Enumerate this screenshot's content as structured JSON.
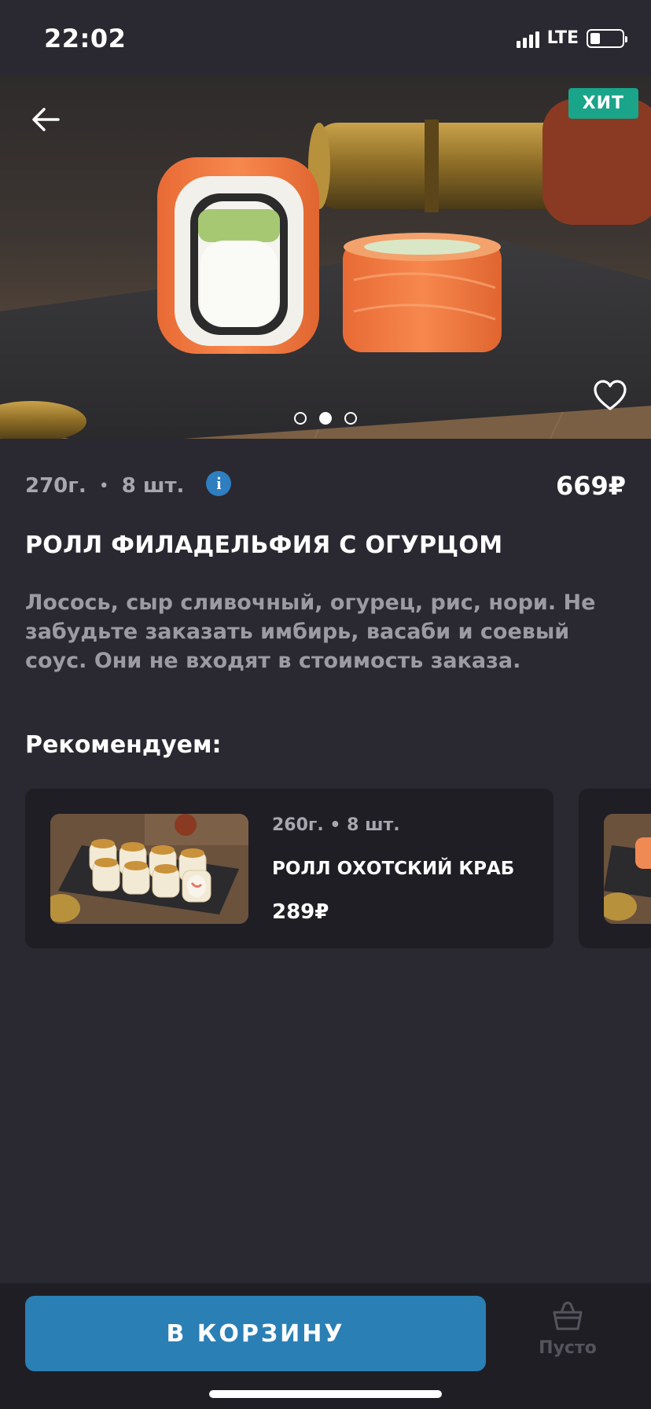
{
  "status_bar": {
    "time": "22:02",
    "network": "LTE"
  },
  "hero": {
    "badge": "ХИТ",
    "carousel": {
      "total": 3,
      "active_index": 1
    },
    "icons": [
      "back-arrow-icon",
      "heart-icon"
    ]
  },
  "product": {
    "weight": "270г.",
    "pieces": "8 шт.",
    "price": "669₽",
    "title": "РОЛЛ ФИЛАДЕЛЬФИЯ С ОГУРЦОМ",
    "description": "Лосось, сыр сливочный, огурец, рис, нори. Не забудьте заказать имбирь, васаби и соевый соус. Они не входят в стоимость заказа."
  },
  "recommend": {
    "heading": "Рекомендуем:",
    "items": [
      {
        "meta": "260г. • 8 шт.",
        "name": "РОЛЛ ОХОТСКИЙ КРАБ",
        "price": "289₽"
      }
    ]
  },
  "bottom_bar": {
    "cart_button": "В КОРЗИНУ",
    "basket_label": "Пусто"
  },
  "colors": {
    "background": "#2a2830",
    "card": "#1f1e24",
    "accent_button": "#2a7fb5",
    "badge": "#1aa48a",
    "info_icon": "#2f7ec0"
  }
}
